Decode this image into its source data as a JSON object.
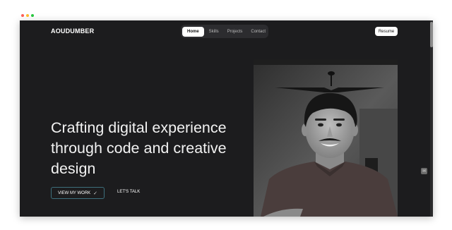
{
  "window": {
    "dot_colors": [
      "#ff5f57",
      "#febc2e",
      "#28c840"
    ]
  },
  "header": {
    "logo": "AOUDUMBER",
    "nav": [
      "Home",
      "Skills",
      "Projects",
      "Contact"
    ],
    "active_nav": "Home",
    "resume_label": "Resume"
  },
  "hero": {
    "headline_lines": [
      "Crafting digital experience",
      "through code and creative",
      "design"
    ],
    "primary_cta": "VIEW MY WORK",
    "primary_cta_icon": "check-icon",
    "secondary_cta": "LET'S TALK"
  },
  "side": {
    "icon": "mail-icon"
  },
  "colors": {
    "background": "#1c1c1e",
    "nav_bg": "#2c2c2f",
    "accent_border": "#3d6f7c",
    "text": "#f2f2f2"
  }
}
